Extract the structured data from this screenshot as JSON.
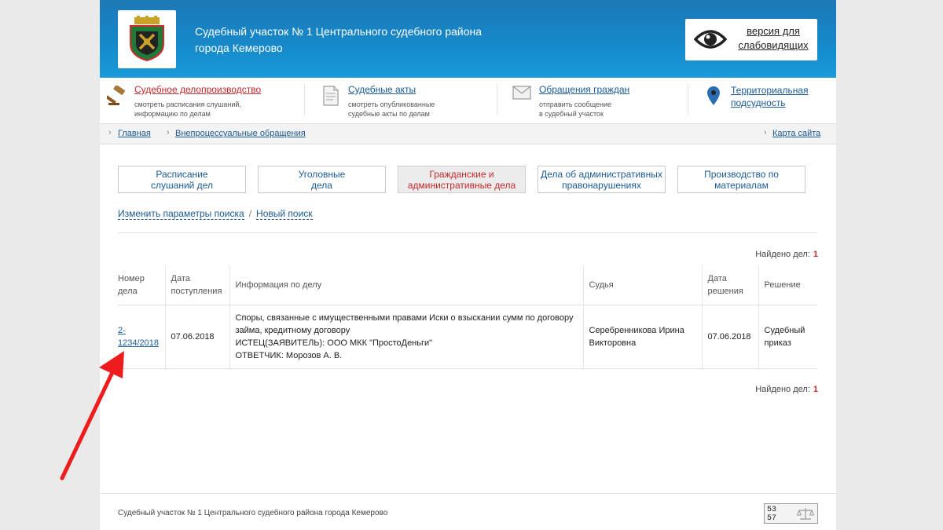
{
  "header": {
    "title_line1": "Судебный участок № 1 Центрального судебного района",
    "title_line2": "города Кемерово",
    "vision_line1": "версия для",
    "vision_line2": "слабовидящих",
    "vision_icon": "eye-icon"
  },
  "nav": [
    {
      "title": "Судебное делопроизводство",
      "desc1": "смотреть расписания слушаний,",
      "desc2": "информацию по делам",
      "icon": "gavel-icon"
    },
    {
      "title": "Судебные акты",
      "desc1": "смотреть опубликованные",
      "desc2": "судебные акты по делам",
      "icon": "document-icon"
    },
    {
      "title": "Обращения граждан",
      "desc1": "отправить сообщение",
      "desc2": "в судебный участок",
      "icon": "envelope-icon"
    },
    {
      "title": "Территориальная",
      "title2": "подсудность",
      "icon": "map-pin-icon"
    }
  ],
  "breadcrumbs": {
    "home": "Главная",
    "current": "Внепроцессуальные обращения",
    "sitemap": "Карта сайта"
  },
  "tabs": [
    {
      "line1": "Расписание",
      "line2": "слушаний дел"
    },
    {
      "line1": "Уголовные",
      "line2": "дела"
    },
    {
      "line1": "Гражданские и",
      "line2": "административные дела"
    },
    {
      "line1": "Дела об административных",
      "line2": "правонарушениях"
    },
    {
      "line1": "Производство по",
      "line2": "материалам"
    }
  ],
  "search": {
    "change": "Изменить параметры поиска",
    "sep": "/",
    "new": "Новый поиск"
  },
  "found": {
    "label": "Найдено дел:",
    "count": "1"
  },
  "table": {
    "headers": {
      "num1": "Номер",
      "num2": "дела",
      "date1": "Дата",
      "date2": "поступления",
      "info": "Информация по делу",
      "judge": "Судья",
      "dec1": "Дата",
      "dec2": "решения",
      "result": "Решение"
    },
    "rows": [
      {
        "num_a": "2-",
        "num_b": "1234/2018",
        "date": "07.06.2018",
        "info1": "Споры, связанные с имущественными правами Иски о взыскании сумм по договору",
        "info2": "займа, кредитному договору",
        "info3": "ИСТЕЦ(ЗАЯВИТЕЛЬ): ООО МКК \"ПростоДеньги\"",
        "info4": "ОТВЕТЧИК: Морозов А. В.",
        "judge1": "Серебренникова Ирина",
        "judge2": "Викторовна",
        "dec_date": "07.06.2018",
        "result1": "Судебный",
        "result2": "приказ"
      }
    ]
  },
  "footer": {
    "text": "Судебный участок № 1 Центрального судебного района города Кемерово",
    "counter1": "53",
    "counter2": "57"
  },
  "colors": {
    "header_blue": "#1688c9",
    "link_blue": "#1b5a94",
    "accent_red": "#c3282b",
    "annotation_red": "#ee1c1c"
  }
}
